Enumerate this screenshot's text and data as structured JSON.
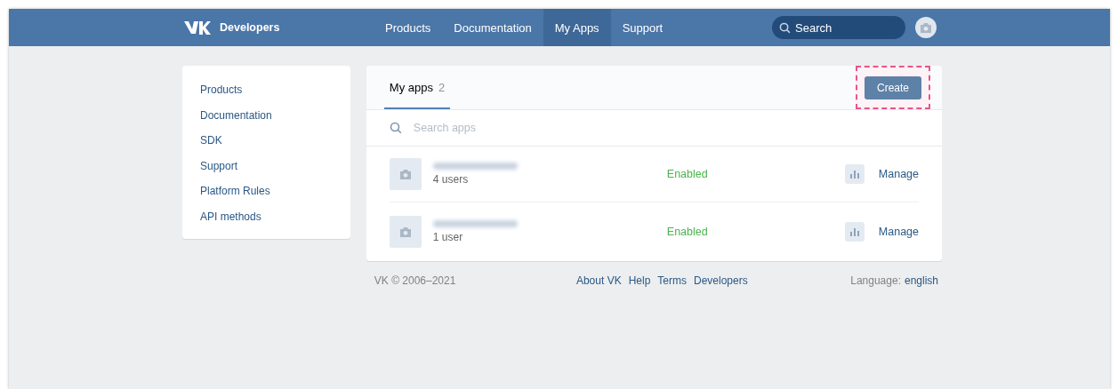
{
  "header": {
    "brand": "Developers",
    "nav": [
      {
        "label": "Products",
        "selected": false
      },
      {
        "label": "Documentation",
        "selected": false
      },
      {
        "label": "My Apps",
        "selected": true
      },
      {
        "label": "Support",
        "selected": false
      }
    ],
    "search": {
      "placeholder": "Search"
    }
  },
  "sidebar": {
    "items": [
      "Products",
      "Documentation",
      "SDK",
      "Support",
      "Platform Rules",
      "API methods"
    ]
  },
  "main": {
    "tab": {
      "label": "My apps",
      "count": "2",
      "selected": true
    },
    "create": {
      "label": "Create",
      "highlighted": true
    },
    "search": {
      "placeholder": "Search apps"
    },
    "apps": [
      {
        "users": "4 users",
        "status": "Enabled",
        "action": "Manage"
      },
      {
        "users": "1 user",
        "status": "Enabled",
        "action": "Manage"
      }
    ]
  },
  "footer": {
    "copyright": "VK © 2006–2021",
    "links": [
      "About VK",
      "Help",
      "Terms",
      "Developers"
    ],
    "language_label": "Language:",
    "language": "english"
  }
}
